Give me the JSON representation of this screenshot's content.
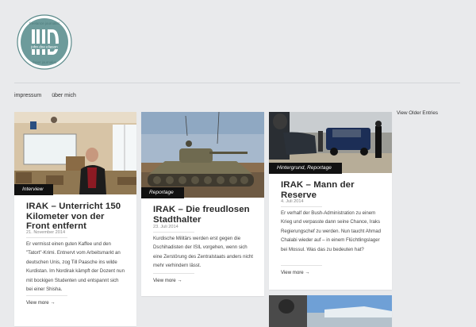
{
  "logo": {
    "text_top": "freelance journalist",
    "text_mid": "john doe eliason",
    "text_bottom": "freier journalist"
  },
  "nav": {
    "items": [
      "impressum",
      "über mich"
    ]
  },
  "older_entries_label": "View Older Entries",
  "cards": [
    {
      "tag": "Interview",
      "title": "Unterricht 150 Kilometer von der Front entfernt",
      "title_prefix": "IRAK –",
      "date": "21. November 2014",
      "excerpt": "Er vermisst einen guten Kaffee und den \"Tatort\"-Krimi. Entnervt vom Arbeitsmarkt an deutschen Unis, zog Till Paasche ins wilde Kurdistan. Im Nordirak kämpft der Dozent nun mit bockigen Studenten und entspannt sich bei einer Shisha.",
      "more": "View more →"
    },
    {
      "tag": "Reportage",
      "title": "Die freudlosen Stadthalter",
      "title_prefix": "IRAK –",
      "date": "23. Juli 2014",
      "excerpt": "Kurdische Militärs werden erst gegen die Dschihadisten der ISIL vorgehen, wenn sich eine Zerstörung des Zentralstaats anders nicht mehr verhindern lässt.",
      "more": "View more →"
    },
    {
      "tag": "Hintergrund, Reportage",
      "title": "Mann der Reserve",
      "title_prefix": "IRAK –",
      "date": "4. Juli 2014",
      "excerpt": "Er verhalf der Bush-Administration zu einem Krieg und verpasste dann seine Chance, Iraks Regierungschef zu werden. Nun taucht Ahmad Chalabi wieder auf – in einem Flüchtlingslager bei Mossul. Was das zu bedeuten hat?",
      "more": "View more →"
    }
  ]
}
